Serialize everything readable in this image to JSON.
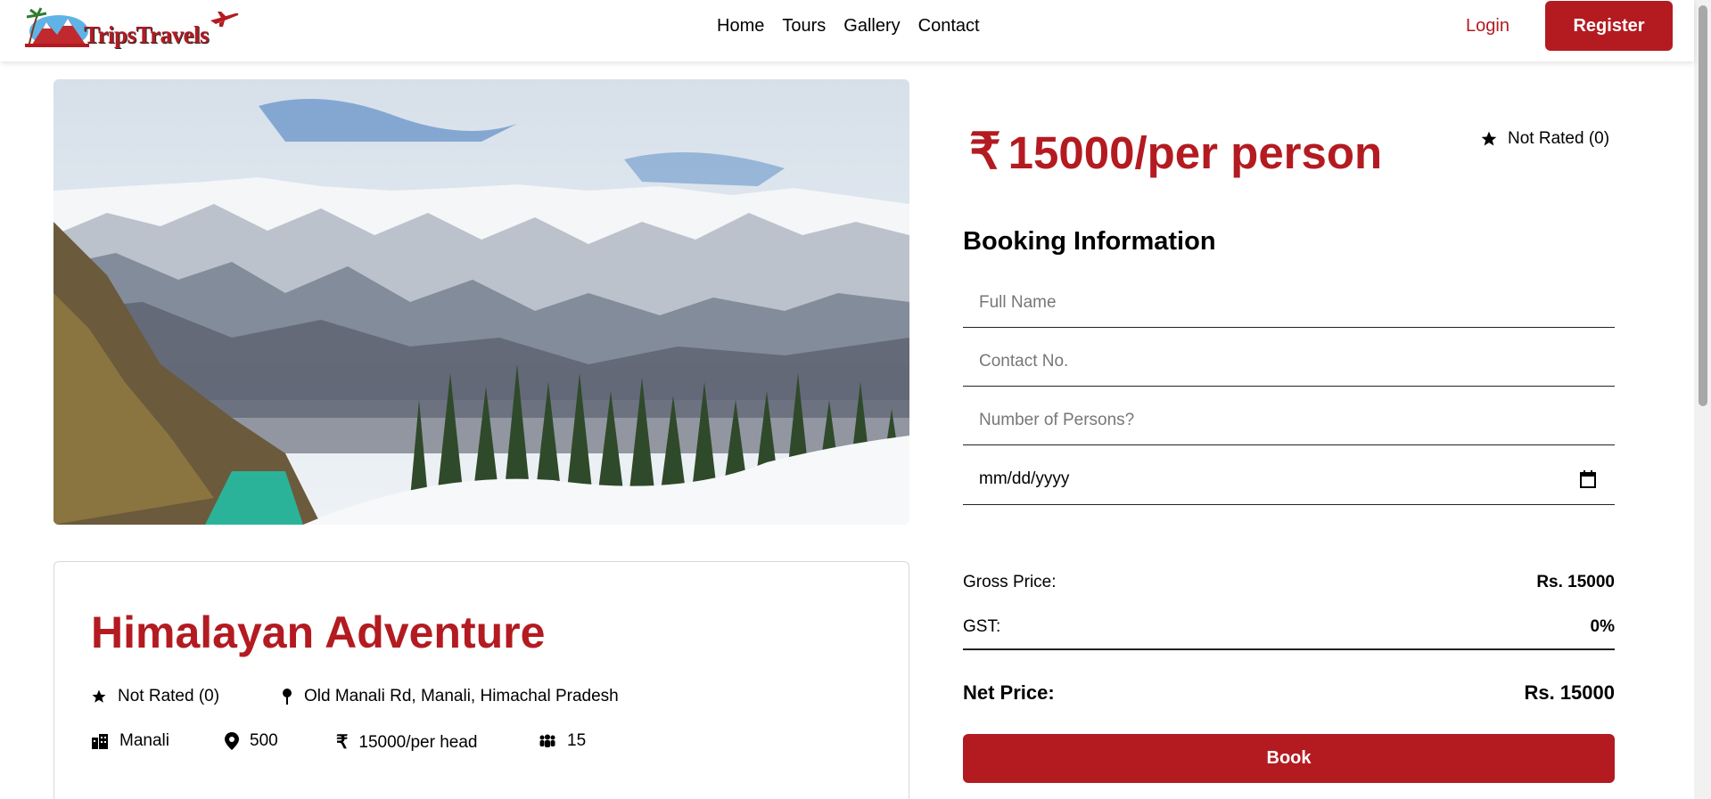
{
  "brand": {
    "logo_text": "TripsTravels",
    "accent": "#b31b21"
  },
  "nav": {
    "links": [
      "Home",
      "Tours",
      "Gallery",
      "Contact"
    ],
    "login": "Login",
    "register": "Register"
  },
  "tour": {
    "title": "Himalayan Adventure",
    "rating": "Not Rated (0)",
    "address": "Old Manali Rd, Manali, Himachal Pradesh",
    "city": "Manali",
    "distance": "500",
    "price_per_head": "15000/per head",
    "max_group": "15"
  },
  "booking": {
    "price_symbol": "₹",
    "price": "15000/per person",
    "rating": "Not Rated (0)",
    "heading": "Booking Information",
    "fields": {
      "full_name_placeholder": "Full Name",
      "contact_placeholder": "Contact No.",
      "persons_placeholder": "Number of Persons?",
      "date_value": "mm/dd/yyyy"
    },
    "gross_label": "Gross Price:",
    "gross_value": "Rs. 15000",
    "gst_label": "GST:",
    "gst_value": "0%",
    "net_label": "Net Price:",
    "net_value": "Rs. 15000",
    "book_label": "Book"
  }
}
